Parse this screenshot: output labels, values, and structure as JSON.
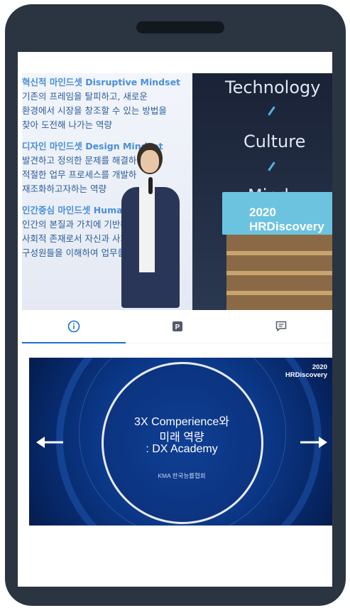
{
  "photo": {
    "slide_lines": [
      {
        "text": "혁신적 마인드셋 Disruptive Mindset",
        "style": "blue"
      },
      {
        "text": "기존의 프레임을 탈피하고, 새로운",
        "style": "dark"
      },
      {
        "text": "환경에서 시장을 창조할 수 있는 방법을",
        "style": "dark"
      },
      {
        "text": "찾아 도전해 나가는 역량",
        "style": "dark"
      },
      {
        "text": "디자인 마인드셋 Design Mindset",
        "style": "blue"
      },
      {
        "text": "발견하고 정의한 문제를 해결하",
        "style": "dark"
      },
      {
        "text": "적절한 업무 프로세스를 개발하",
        "style": "dark"
      },
      {
        "text": "재조화하고자하는 역량",
        "style": "dark"
      },
      {
        "text": "인간중심 마인드셋 Human",
        "style": "blue"
      },
      {
        "text": "인간의 본질과 가치에 기반해",
        "style": "dark"
      },
      {
        "text": "사회적 존재로서 자신과 사회",
        "style": "dark"
      },
      {
        "text": "구성원들을 이해하여 업무를",
        "style": "dark"
      }
    ],
    "stage_words": [
      "Technology",
      "Culture",
      "Mind"
    ],
    "podium_year": "2020",
    "podium_name": "HRDiscovery"
  },
  "tabs": [
    {
      "name": "info",
      "icon": "info-circle-icon",
      "glyph": "i",
      "active": true
    },
    {
      "name": "p",
      "icon": "p-badge-icon",
      "glyph": "P",
      "active": false
    },
    {
      "name": "comments",
      "icon": "comment-icon",
      "glyph": "",
      "active": false
    }
  ],
  "slide": {
    "logo_year": "2020",
    "logo_name": "HRDiscovery",
    "title_line1": "3X Comperience와",
    "title_line2": "미래 역량",
    "title_line3": ": DX Academy",
    "subtitle": "KMA 한국능률협회",
    "prev_icon": "arrow-left-icon",
    "next_icon": "arrow-right-icon"
  },
  "colors": {
    "phone_frame": "#2b3441",
    "accent": "#1d6fd1",
    "slide_bg": "#0c3a8c"
  }
}
